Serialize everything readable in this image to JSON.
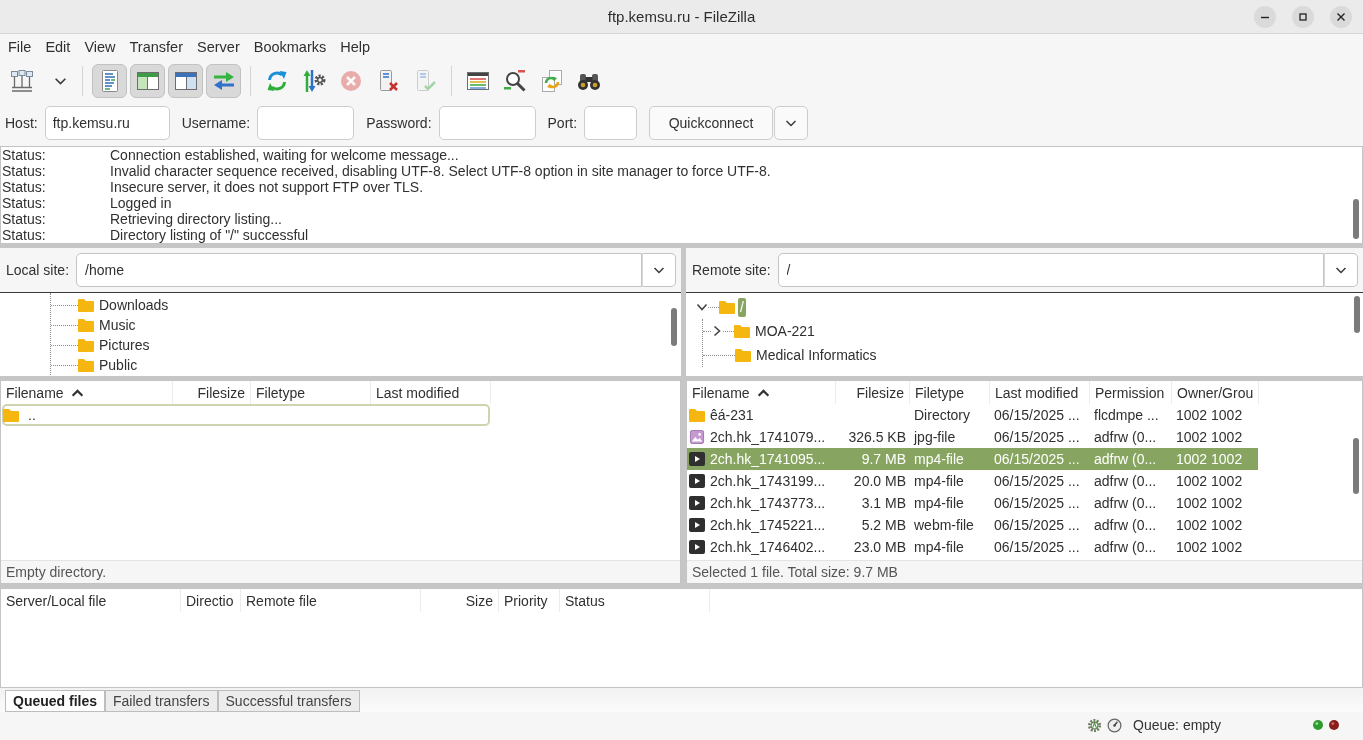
{
  "window": {
    "title": "ftp.kemsu.ru - FileZilla"
  },
  "menu": [
    "File",
    "Edit",
    "View",
    "Transfer",
    "Server",
    "Bookmarks",
    "Help"
  ],
  "toolbar": {
    "view_toggles": [
      {
        "pressed": true
      },
      {
        "pressed": true
      },
      {
        "pressed": true
      },
      {
        "pressed": true
      }
    ],
    "actions": [
      {
        "disabled": false
      },
      {
        "disabled": false
      },
      {
        "disabled": true
      },
      {
        "disabled": false
      },
      {
        "disabled": true
      }
    ]
  },
  "quickconnect": {
    "host": {
      "label": "Host:",
      "value": "ftp.kemsu.ru"
    },
    "username": {
      "label": "Username:"
    },
    "password": {
      "label": "Password:"
    },
    "port": {
      "label": "Port:"
    },
    "button": "Quickconnect"
  },
  "log": [
    {
      "label": "Status:",
      "message": "Connection established, waiting for welcome message..."
    },
    {
      "label": "Status:",
      "message": "Invalid character sequence received, disabling UTF-8. Select UTF-8 option in site manager to force UTF-8."
    },
    {
      "label": "Status:",
      "message": "Insecure server, it does not support FTP over TLS."
    },
    {
      "label": "Status:",
      "message": "Logged in"
    },
    {
      "label": "Status:",
      "message": "Retrieving directory listing..."
    },
    {
      "label": "Status:",
      "message": "Directory listing of \"/\" successful"
    }
  ],
  "local": {
    "site_label": "Local site:",
    "path": "/home",
    "tree": [
      {
        "label": "Downloads",
        "selected": false
      },
      {
        "label": "Music",
        "selected": false
      },
      {
        "label": "Pictures",
        "selected": false
      },
      {
        "label": "Public",
        "selected": false
      }
    ],
    "columns": [
      {
        "label": "Filename",
        "sorted": true
      },
      {
        "label": "Filesize",
        "sorted": false
      },
      {
        "label": "Filetype",
        "sorted": false
      },
      {
        "label": "Last modified",
        "sorted": false
      }
    ],
    "rows": [
      {
        "kind": "folder",
        "name": "..",
        "selected": false,
        "focused": true
      }
    ],
    "status": "Empty directory."
  },
  "remote": {
    "site_label": "Remote site:",
    "path": "/",
    "tree": [
      {
        "label": "/",
        "has_children": true,
        "expanded": true,
        "selected": true,
        "children": [
          {
            "label": "MOA-221",
            "has_children": true,
            "expanded": false,
            "selected": false
          },
          {
            "label": "Medical Informatics",
            "has_children": false,
            "selected": false
          }
        ]
      }
    ],
    "columns": [
      {
        "label": "Filename",
        "sorted": true
      },
      {
        "label": "Filesize",
        "sorted": false
      },
      {
        "label": "Filetype",
        "sorted": false
      },
      {
        "label": "Last modified",
        "sorted": false
      },
      {
        "label": "Permission",
        "sorted": false
      },
      {
        "label": "Owner/Grou",
        "sorted": false
      }
    ],
    "rows": [
      {
        "kind": "folder",
        "name": "êá-231",
        "type": "Directory",
        "modified": "06/15/2025 ...",
        "permissions": "flcdmpe ...",
        "owner": "1002 1002",
        "selected": false
      },
      {
        "kind": "image",
        "name": "2ch.hk_1741079...",
        "size": "326.5 KB",
        "type": "jpg-file",
        "modified": "06/15/2025 ...",
        "permissions": "adfrw (0...",
        "owner": "1002 1002",
        "selected": false
      },
      {
        "kind": "video",
        "name": "2ch.hk_1741095...",
        "size": "9.7 MB",
        "type": "mp4-file",
        "modified": "06/15/2025 ...",
        "permissions": "adfrw (0...",
        "owner": "1002 1002",
        "selected": true
      },
      {
        "kind": "video",
        "name": "2ch.hk_1743199...",
        "size": "20.0 MB",
        "type": "mp4-file",
        "modified": "06/15/2025 ...",
        "permissions": "adfrw (0...",
        "owner": "1002 1002",
        "selected": false
      },
      {
        "kind": "video",
        "name": "2ch.hk_1743773...",
        "size": "3.1 MB",
        "type": "mp4-file",
        "modified": "06/15/2025 ...",
        "permissions": "adfrw (0...",
        "owner": "1002 1002",
        "selected": false
      },
      {
        "kind": "video",
        "name": "2ch.hk_1745221...",
        "size": "5.2 MB",
        "type": "webm-file",
        "modified": "06/15/2025 ...",
        "permissions": "adfrw (0...",
        "owner": "1002 1002",
        "selected": false
      },
      {
        "kind": "video",
        "name": "2ch.hk_1746402...",
        "size": "23.0 MB",
        "type": "mp4-file",
        "modified": "06/15/2025 ...",
        "permissions": "adfrw (0...",
        "owner": "1002 1002",
        "selected": false
      }
    ],
    "status": "Selected 1 file. Total size: 9.7 MB"
  },
  "queue": {
    "columns": [
      "Server/Local file",
      "Directio",
      "Remote file",
      "Size",
      "Priority",
      "Status"
    ]
  },
  "tabs": [
    {
      "label": "Queued files",
      "selected": true
    },
    {
      "label": "Failed transfers",
      "selected": false
    },
    {
      "label": "Successful transfers",
      "selected": false
    }
  ],
  "status_bar": {
    "queue": "Queue: empty"
  }
}
